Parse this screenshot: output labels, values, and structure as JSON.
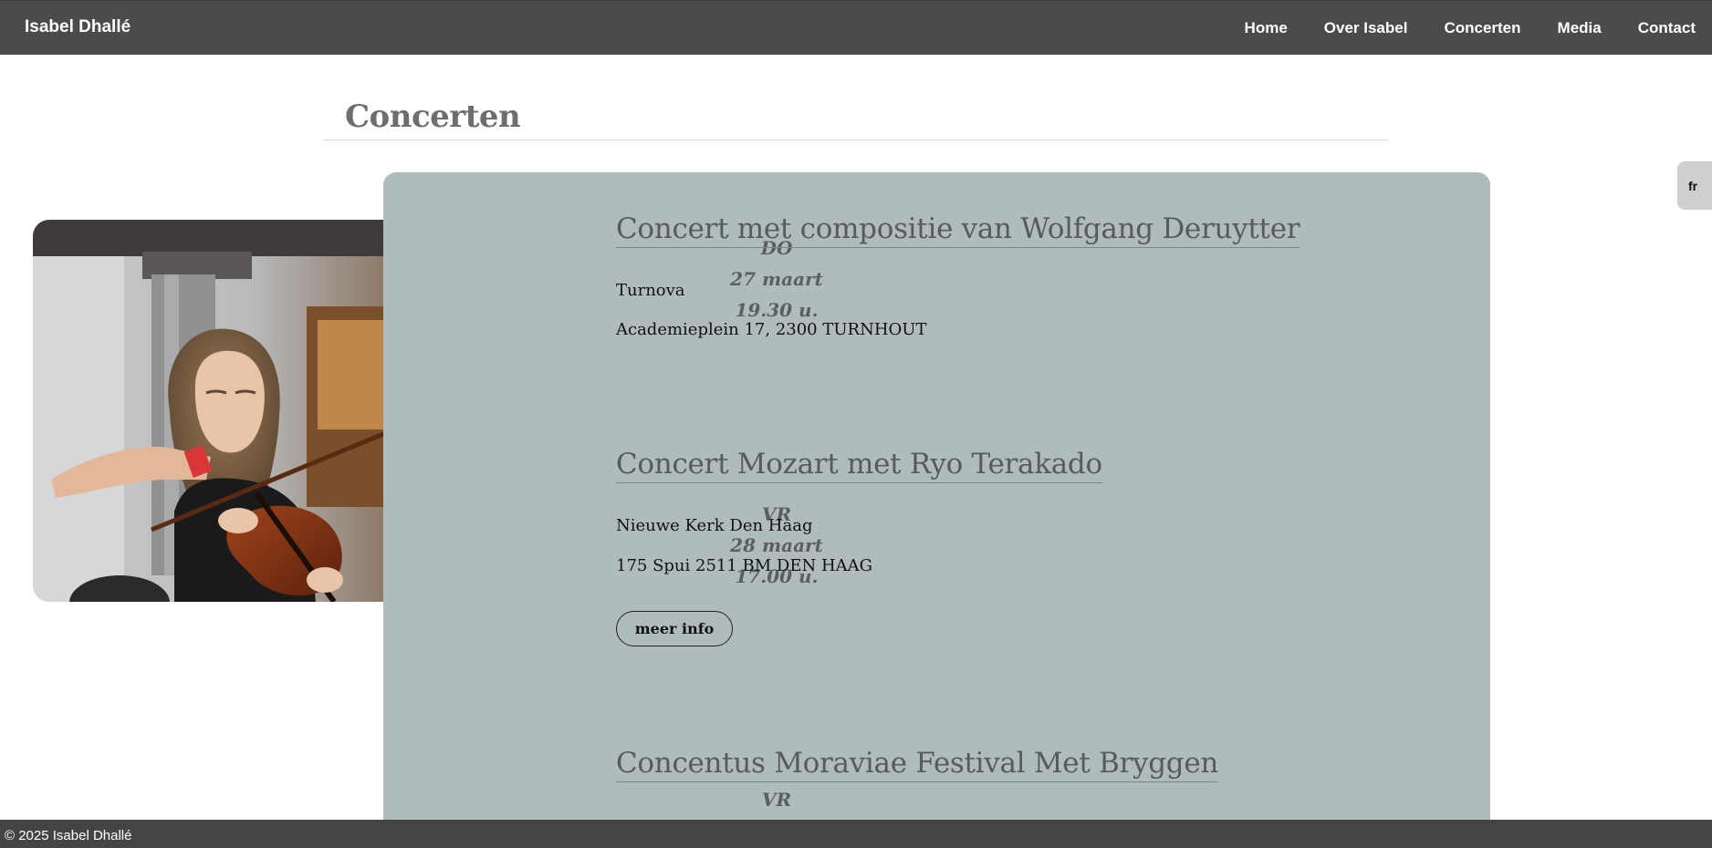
{
  "nav": {
    "brand": "Isabel Dhallé",
    "links": [
      "Home",
      "Over Isabel",
      "Concerten",
      "Media",
      "Contact"
    ]
  },
  "page": {
    "title": "Concerten"
  },
  "events": [
    {
      "day": "DO",
      "date": "27 maart",
      "time": "19.30 u.",
      "title": "Concert met compositie van Wolfgang Deruytter",
      "venue": "Turnova",
      "address": "Academieplein 17, 2300 TURNHOUT"
    },
    {
      "day": "VR",
      "date": "28 maart",
      "time": "17.00 u.",
      "title": "Concert Mozart met Ryo Terakado",
      "venue": "Nieuwe Kerk Den Haag",
      "address": "175 Spui 2511 BM DEN HAAG",
      "button": "meer info"
    },
    {
      "day": "VR",
      "title": "Concentus Moraviae Festival Met Bryggen"
    }
  ],
  "language_toggle": "fr",
  "footer": {
    "copyright": "© 2025 Isabel Dhallé"
  },
  "icons": {
    "photo": "violinist-photo"
  },
  "colors": {
    "navbar": "#4b4b4b",
    "panel": "#b0bcbc",
    "title": "#6e6e6e",
    "event_title": "#555c5e",
    "footer": "#444444"
  }
}
